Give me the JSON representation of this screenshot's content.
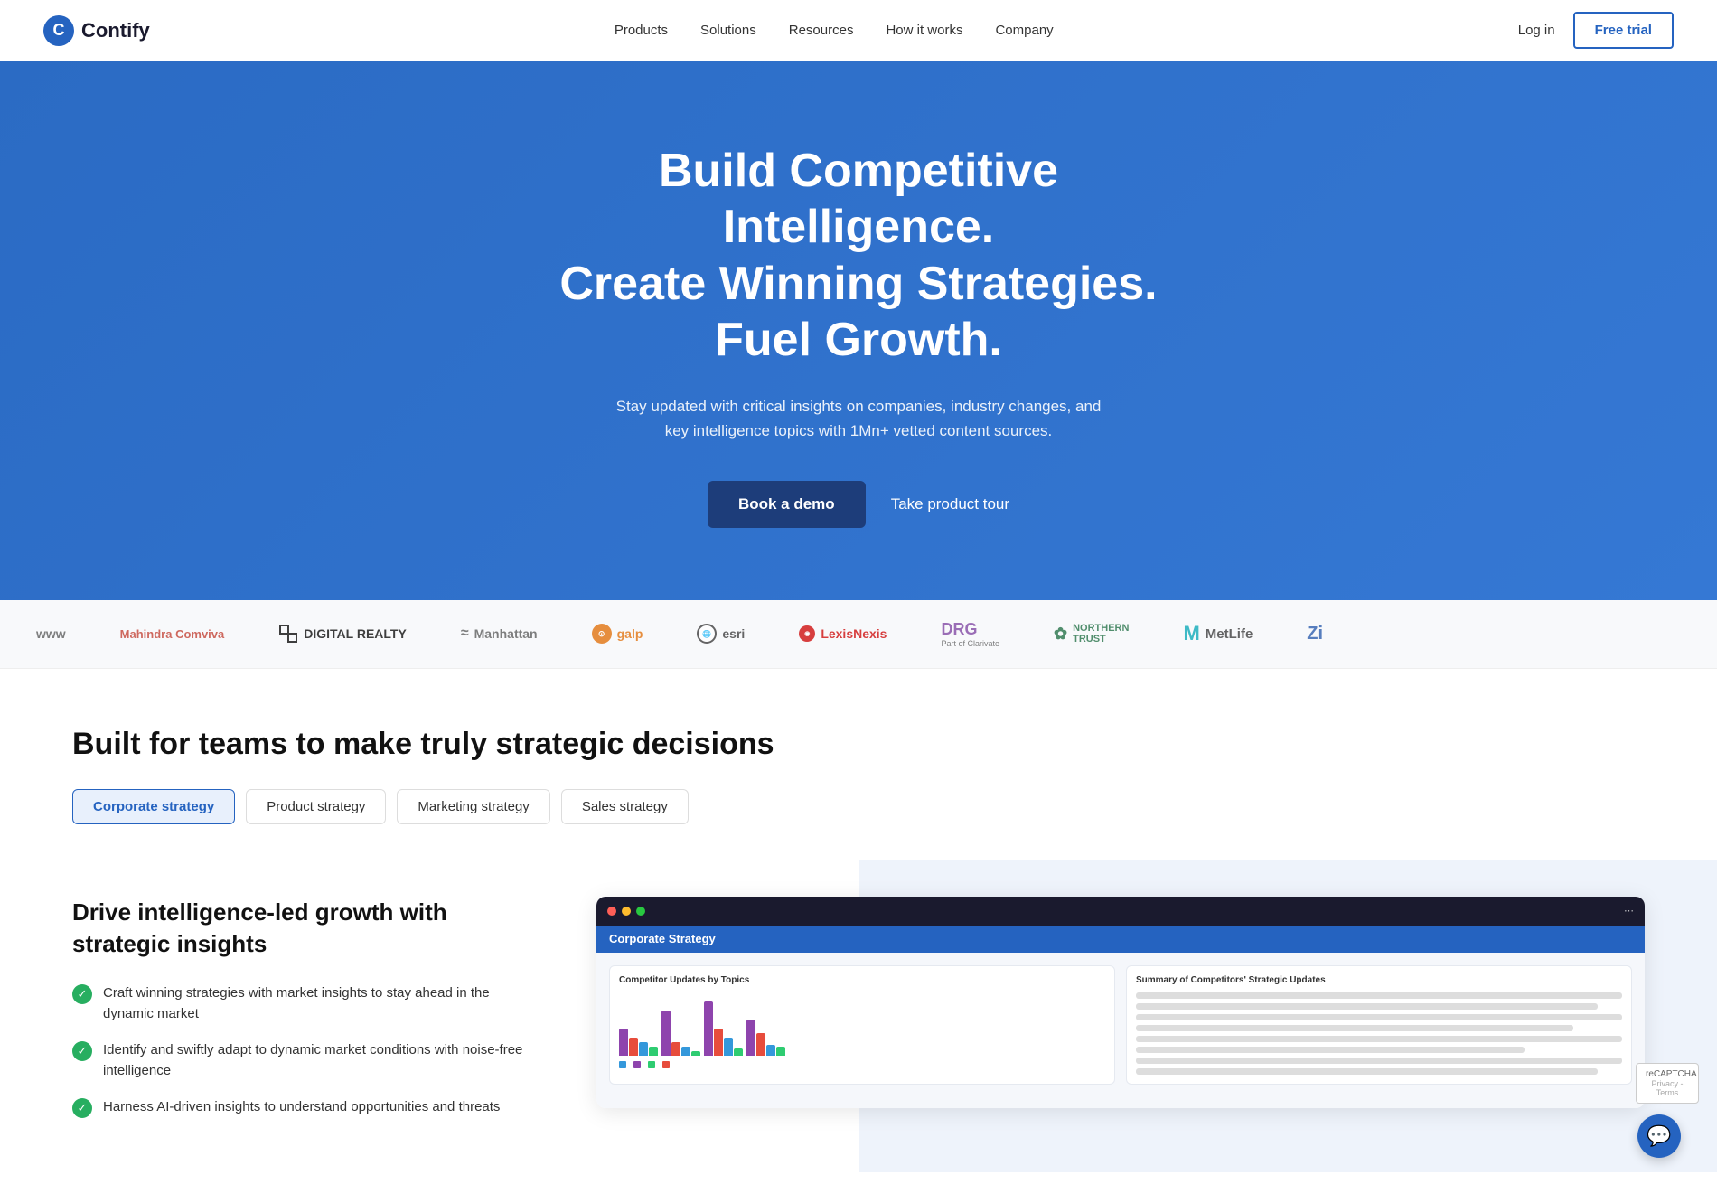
{
  "brand": {
    "logo_letter": "C",
    "name": "Contify"
  },
  "navbar": {
    "links": [
      {
        "id": "products",
        "label": "Products"
      },
      {
        "id": "solutions",
        "label": "Solutions"
      },
      {
        "id": "resources",
        "label": "Resources"
      },
      {
        "id": "how-it-works",
        "label": "How it works"
      },
      {
        "id": "company",
        "label": "Company"
      }
    ],
    "login_label": "Log in",
    "free_trial_label": "Free trial"
  },
  "hero": {
    "heading_line1": "Build Competitive Intelligence.",
    "heading_line2": "Create Winning Strategies.",
    "heading_line3": "Fuel Growth.",
    "subtext": "Stay updated with critical insights on companies, industry changes, and key intelligence topics with 1Mn+ vetted content sources.",
    "book_demo_label": "Book a demo",
    "product_tour_label": "Take product tour"
  },
  "logos": [
    {
      "id": "www",
      "label": "www",
      "type": "text"
    },
    {
      "id": "mahindra",
      "label": "Mahindra Comviva",
      "type": "mahindra"
    },
    {
      "id": "digital",
      "label": "DIGITAL REALTY",
      "type": "digital"
    },
    {
      "id": "manhattan",
      "label": "Manhattan",
      "type": "text"
    },
    {
      "id": "galp",
      "label": "galp",
      "type": "galp"
    },
    {
      "id": "esri",
      "label": "esri",
      "type": "esri"
    },
    {
      "id": "lexis",
      "label": "LexisNexis",
      "type": "lexis"
    },
    {
      "id": "drg",
      "label": "DRG Part of Clarivate",
      "type": "drg"
    },
    {
      "id": "northern",
      "label": "NORTHERN TRUST",
      "type": "northern"
    },
    {
      "id": "metlife",
      "label": "MetLife",
      "type": "metlife"
    },
    {
      "id": "z",
      "label": "Zi",
      "type": "text"
    }
  ],
  "strategy": {
    "section_title": "Built for teams to make truly strategic decisions",
    "tabs": [
      {
        "id": "corporate",
        "label": "Corporate strategy",
        "active": true
      },
      {
        "id": "product",
        "label": "Product strategy",
        "active": false
      },
      {
        "id": "marketing",
        "label": "Marketing strategy",
        "active": false
      },
      {
        "id": "sales",
        "label": "Sales strategy",
        "active": false
      }
    ]
  },
  "content": {
    "heading": "Drive intelligence-led growth with strategic insights",
    "features": [
      "Craft winning strategies with market insights to stay ahead in the dynamic market",
      "Identify and swiftly adapt to dynamic market conditions with noise-free intelligence",
      "Harness AI-driven insights to understand opportunities and threats"
    ],
    "dashboard": {
      "title": "Corporate Strategy",
      "chart_title": "Competitor Updates by Topics",
      "summary_title": "Summary of Competitors' Strategic Updates"
    }
  },
  "chatbot": {
    "label": "💬"
  },
  "recaptcha": {
    "label": "reCAPTCHA",
    "sub": "Privacy - Terms"
  }
}
